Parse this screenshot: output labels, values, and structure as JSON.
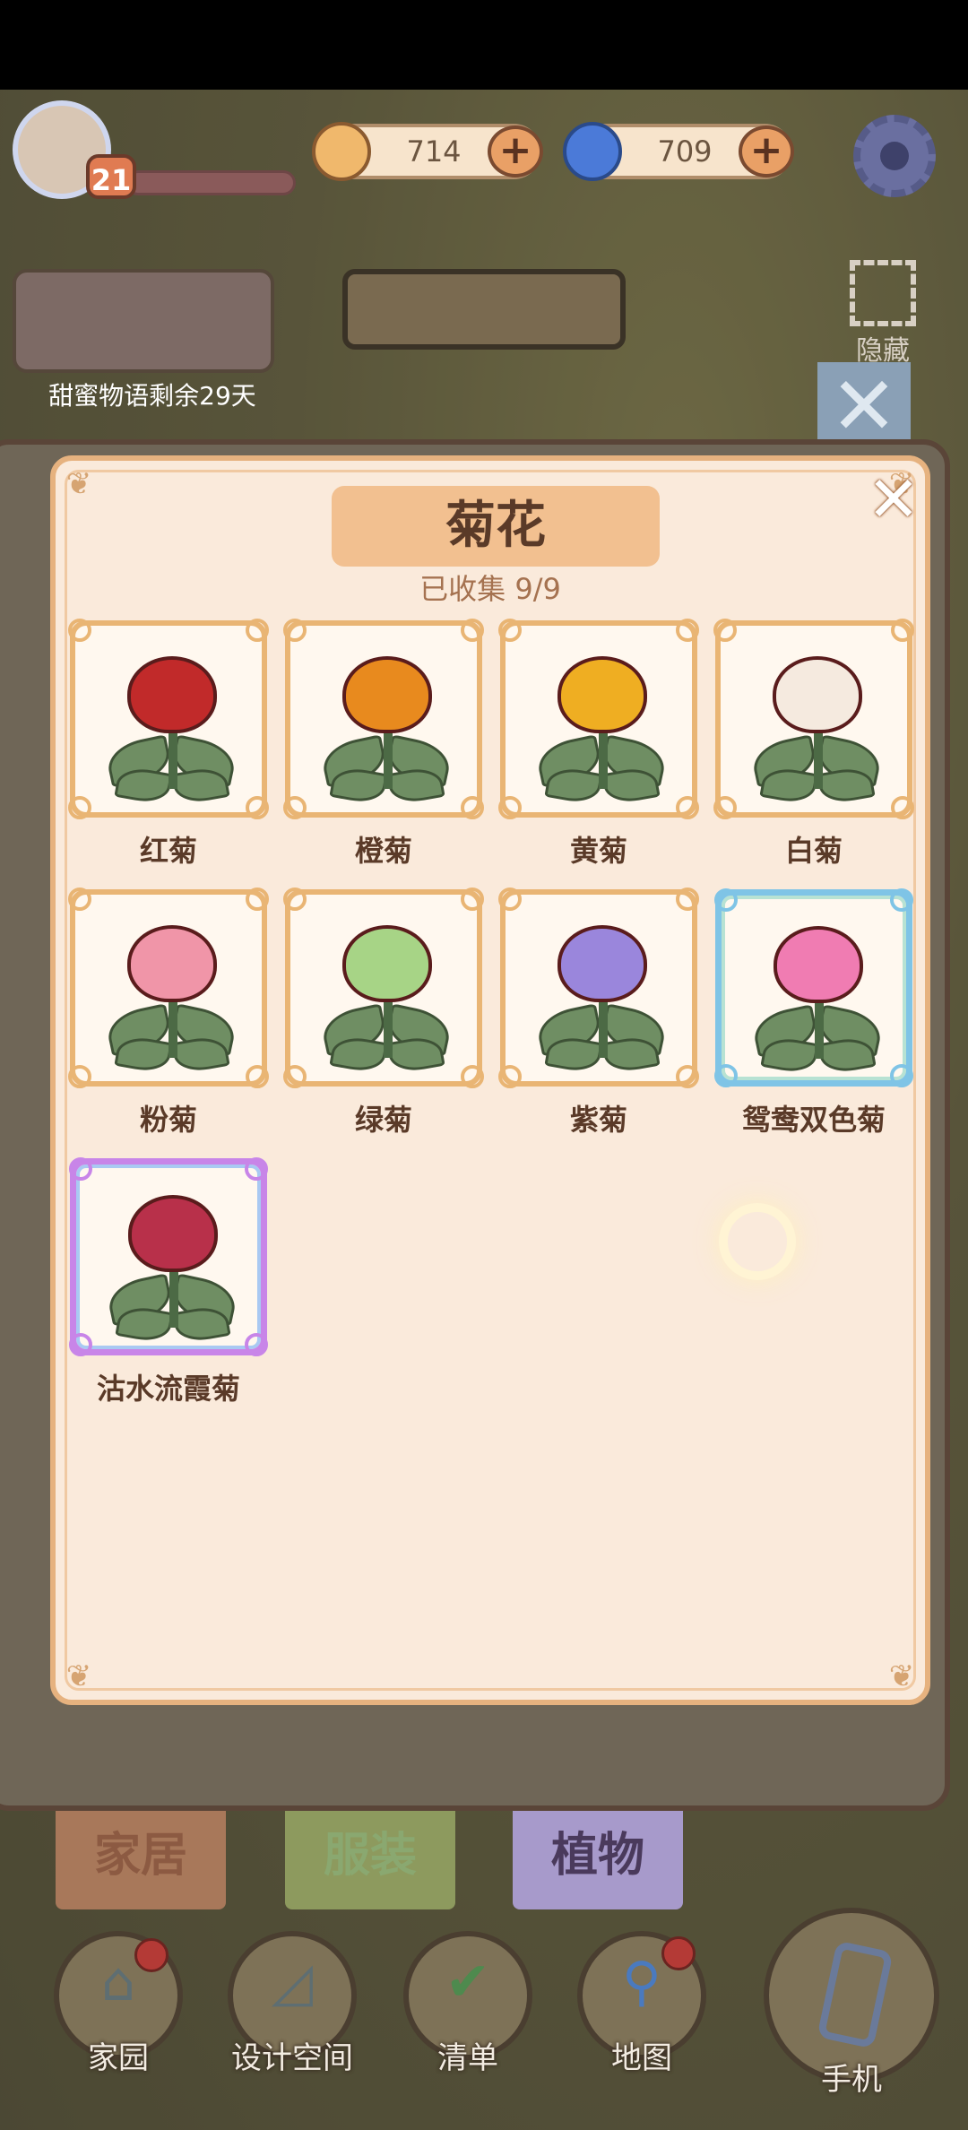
{
  "hud": {
    "level": "21",
    "coins": "714",
    "gems": "709",
    "coin_add": "+",
    "gem_add": "+",
    "event_label": "甜蜜物语剩余29天",
    "hide_label": "隐藏",
    "bg_close": "✕"
  },
  "modal": {
    "title": "菊花",
    "collected": "已收集 9/9",
    "close": "✕",
    "items": [
      {
        "name": "红菊",
        "color": "#c12a2a",
        "rarity": "common"
      },
      {
        "name": "橙菊",
        "color": "#e88a1e",
        "rarity": "common"
      },
      {
        "name": "黄菊",
        "color": "#efae22",
        "rarity": "common"
      },
      {
        "name": "白菊",
        "color": "#f5eadf",
        "rarity": "common"
      },
      {
        "name": "粉菊",
        "color": "#f095a8",
        "rarity": "common"
      },
      {
        "name": "绿菊",
        "color": "#a7d486",
        "rarity": "common"
      },
      {
        "name": "紫菊",
        "color": "#9a86dc",
        "rarity": "common"
      },
      {
        "name": "鸳鸯双色菊",
        "color": "#f07cb2",
        "rarity": "rare"
      },
      {
        "name": "沽水流霞菊",
        "color": "#b8304a",
        "rarity": "epic"
      }
    ]
  },
  "tabs": {
    "home": "家居",
    "clothing": "服装",
    "plants": "植物"
  },
  "nav": {
    "garden": "家园",
    "design": "设计空间",
    "list": "清单",
    "map": "地图",
    "phone": "手机"
  },
  "colors": {
    "modal_bg": "#faeadb",
    "border": "#e6b27f",
    "title_pill": "#f2c090",
    "text_brown": "#5a3a28",
    "rare_border": "#7fc4e6",
    "epic_border": "#c885e8"
  }
}
